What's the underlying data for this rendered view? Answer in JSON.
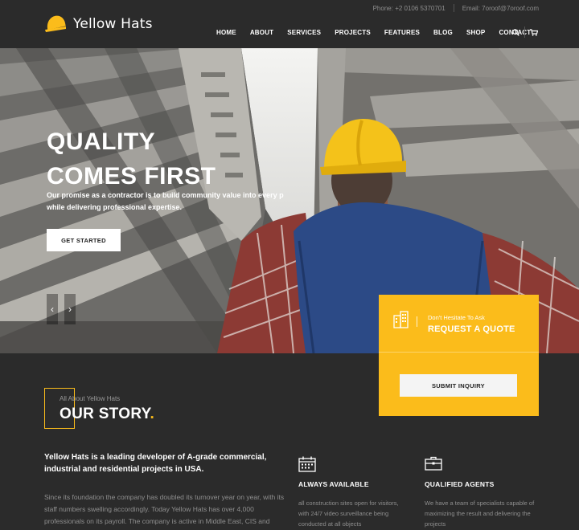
{
  "header": {
    "logo_text": "Yellow Hats",
    "phone_label": "Phone:",
    "phone_value": "+2 0106 5370701",
    "email_label": "Email:",
    "email_value": "7oroof@7oroof.com",
    "nav": [
      "HOME",
      "ABOUT",
      "SERVICES",
      "PROJECTS",
      "FEATURES",
      "BLOG",
      "SHOP",
      "CONTACT"
    ]
  },
  "hero": {
    "title_line1": "QUALITY",
    "title_line2": "COMES FIRST",
    "subtitle": "Our promise as a contractor is to build community value into every p... while delivering professional expertise.",
    "subtitle_line1": "Our promise as a contractor is to build community value into every p",
    "subtitle_line2": "while delivering professional expertise.",
    "button": "GET STARTED",
    "prev": "‹",
    "next": "›"
  },
  "quote": {
    "small": "Don't Hesitate To Ask",
    "title": "REQUEST A QUOTE",
    "button": "SUBMIT INQUIRY"
  },
  "story": {
    "eyebrow": "All About Yellow Hats",
    "title": "OUR STORY",
    "title_dot": ".",
    "lead": "Yellow Hats is a leading developer of A-grade commercial, industrial and residential projects in USA.",
    "body": "Since its foundation the company has doubled its turnover year on year, with its staff numbers swelling accordingly. Today Yellow Hats has over 4,000 professionals on its payroll. The company is active in Middle East, CIS and Europe. Yellow Hats has a team of specialists capable of maximizing..."
  },
  "features": [
    {
      "icon": "calendar-icon",
      "title": "ALWAYS AVAILABLE",
      "text": "all construction sites open for visitors, with 24/7 video surveillance being conducted at all objects"
    },
    {
      "icon": "briefcase-icon",
      "title": "QUALIFIED AGENTS",
      "text": "We have a team of specialists capable of maximizing the result and delivering the projects"
    }
  ],
  "colors": {
    "accent": "#fbbc1b",
    "background": "#2b2b2b"
  }
}
